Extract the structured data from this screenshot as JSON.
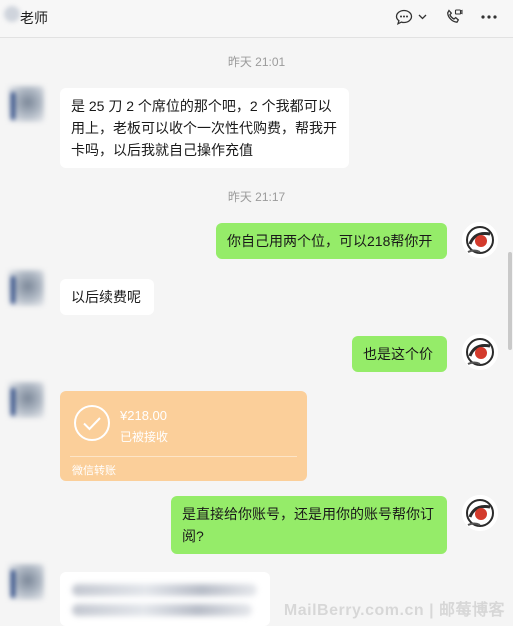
{
  "header": {
    "title": "老师",
    "icons": {
      "chat": "chat-bubble-icon",
      "dropdown": "chevron-down-icon",
      "call": "phone-video-icon",
      "more": "more-dots-icon"
    }
  },
  "messages": {
    "ts1": "昨天 21:01",
    "msg1": "是 25 刀 2 个席位的那个吧，2 个我都可以用上，老板可以收个一次性代购费，帮我开卡吗，以后我就自己操作充值",
    "ts2": "昨天 21:17",
    "msg2": "你自己用两个位，可以218帮你开",
    "msg3": "以后续费呢",
    "msg4": "也是这个价",
    "transfer": {
      "amount": "¥218.00",
      "status": "已被接收",
      "label": "微信转账"
    },
    "msg5": "是直接给你账号，还是用你的账号帮你订阅?"
  },
  "watermark": "MailBerry.com.cn | 邮莓博客",
  "colors": {
    "out_bubble": "#95ec69",
    "in_bubble": "#ffffff",
    "transfer": "#fbcf9a",
    "background": "#f5f5f5"
  }
}
